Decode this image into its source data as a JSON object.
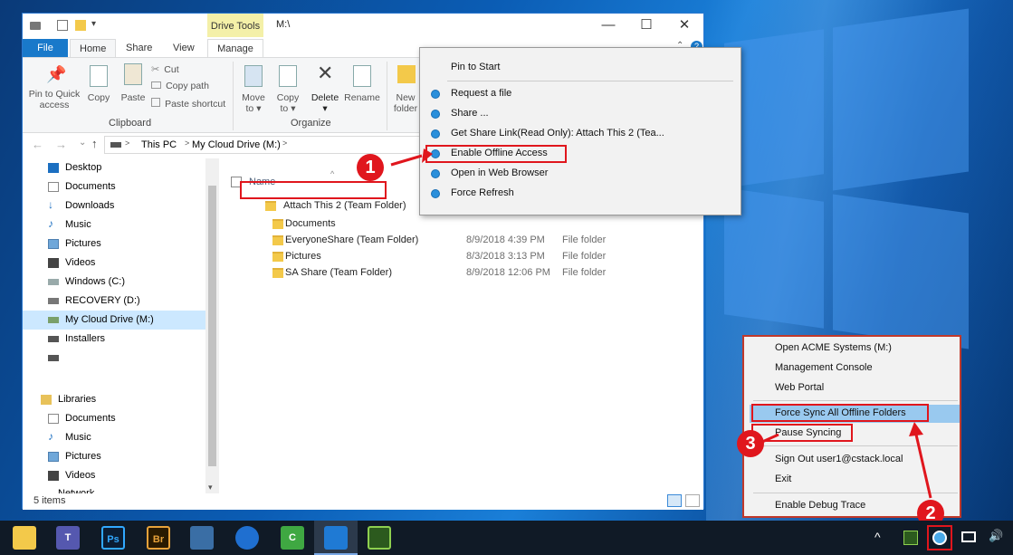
{
  "window": {
    "title": "M:\\",
    "contextual_tab_group": "Drive Tools",
    "controls": {
      "minimize": "—",
      "maximize": "☐",
      "close": "✕"
    }
  },
  "ribbon_tabs": [
    "File",
    "Home",
    "Share",
    "View",
    "Manage"
  ],
  "ribbon": {
    "clipboard": {
      "group_label": "Clipboard",
      "pin_label": "Pin to Quick access",
      "copy_label": "Copy",
      "paste_label": "Paste",
      "cut_label": "Cut",
      "copy_path_label": "Copy path",
      "paste_shortcut_label": "Paste shortcut"
    },
    "organize": {
      "group_label": "Organize",
      "move_to_label": "Move to ▾",
      "copy_to_label": "Copy to ▾",
      "delete_label": "Delete ▾",
      "rename_label": "Rename"
    },
    "new": {
      "new_folder_label": "New folder"
    }
  },
  "address_bar": {
    "back": "←",
    "forward": "→",
    "recent": "⌄",
    "up": "↑",
    "path": [
      "This PC",
      "My Cloud Drive (M:)"
    ],
    "separator": ">",
    "dropdown": "⌄"
  },
  "nav_pane": {
    "items": [
      {
        "label": "Desktop",
        "icon": "desktop-icon"
      },
      {
        "label": "Documents",
        "icon": "documents-icon"
      },
      {
        "label": "Downloads",
        "icon": "downloads-icon"
      },
      {
        "label": "Music",
        "icon": "music-icon"
      },
      {
        "label": "Pictures",
        "icon": "pictures-icon"
      },
      {
        "label": "Videos",
        "icon": "videos-icon"
      },
      {
        "label": "Windows (C:)",
        "icon": "drive-icon"
      },
      {
        "label": "RECOVERY (D:)",
        "icon": "drive-icon"
      },
      {
        "label": "My Cloud Drive (M:)",
        "icon": "cloud-drive-icon"
      },
      {
        "label": "Installers",
        "icon": "network-drive-icon"
      },
      {
        "label": "",
        "icon": "network-drive-icon"
      },
      {
        "label": "Libraries",
        "icon": "libraries-icon"
      },
      {
        "label": "Documents",
        "icon": "documents-icon"
      },
      {
        "label": "Music",
        "icon": "music-icon"
      },
      {
        "label": "Pictures",
        "icon": "pictures-icon"
      },
      {
        "label": "Videos",
        "icon": "videos-icon"
      },
      {
        "label": "Network",
        "icon": "network-icon"
      }
    ],
    "selected_index": 8
  },
  "file_list": {
    "column_name": "Name",
    "sort_indicator": "^",
    "rows": [
      {
        "name": "Attach This 2 (Team Folder)",
        "date": "",
        "type": ""
      },
      {
        "name": "Documents",
        "date": "",
        "type": ""
      },
      {
        "name": "EveryoneShare (Team Folder)",
        "date": "8/9/2018 4:39 PM",
        "type": "File folder"
      },
      {
        "name": "Pictures",
        "date": "8/3/2018 3:13 PM",
        "type": "File folder"
      },
      {
        "name": "SA Share (Team Folder)",
        "date": "8/9/2018 12:06 PM",
        "type": "File folder"
      }
    ]
  },
  "status_bar": {
    "item_count": "5 items"
  },
  "context_menu": {
    "items": [
      {
        "label": "Pin to Start",
        "has_icon": false
      },
      {
        "label": "Request a file",
        "has_icon": true
      },
      {
        "label": "Share ...",
        "has_icon": true
      },
      {
        "label": "Get Share Link(Read Only): Attach This 2 (Tea...",
        "has_icon": true
      },
      {
        "label": "Enable Offline Access",
        "has_icon": true
      },
      {
        "label": "Open in Web Browser",
        "has_icon": true
      },
      {
        "label": "Force Refresh",
        "has_icon": true
      }
    ]
  },
  "tray_menu": {
    "items": [
      "Open ACME Systems (M:)",
      "Management Console",
      "Web Portal",
      "Force Sync All Offline Folders",
      "Pause Syncing",
      "Sign Out user1@cstack.local",
      "Exit",
      "Enable Debug Trace"
    ],
    "highlighted_index": 3
  },
  "callouts": [
    "1",
    "2",
    "3"
  ],
  "taskbar": {
    "apps": [
      {
        "name": "file-explorer-icon",
        "text": ""
      },
      {
        "name": "teams-icon",
        "text": "T"
      },
      {
        "name": "photoshop-icon",
        "text": "Ps"
      },
      {
        "name": "bridge-icon",
        "text": "Br"
      },
      {
        "name": "remote-desktop-icon",
        "text": ""
      },
      {
        "name": "maps-icon",
        "text": ""
      },
      {
        "name": "camtasia-icon",
        "text": "C"
      },
      {
        "name": "vscode-icon",
        "text": ""
      },
      {
        "name": "snip-icon",
        "text": ""
      }
    ],
    "tray": {
      "chevron": "^",
      "speaker": "🔊"
    }
  },
  "colors": {
    "accent": "#1979ca",
    "callout_red": "#e0161d",
    "selection": "#cce8ff",
    "drive_tools": "#f4f0a8"
  }
}
